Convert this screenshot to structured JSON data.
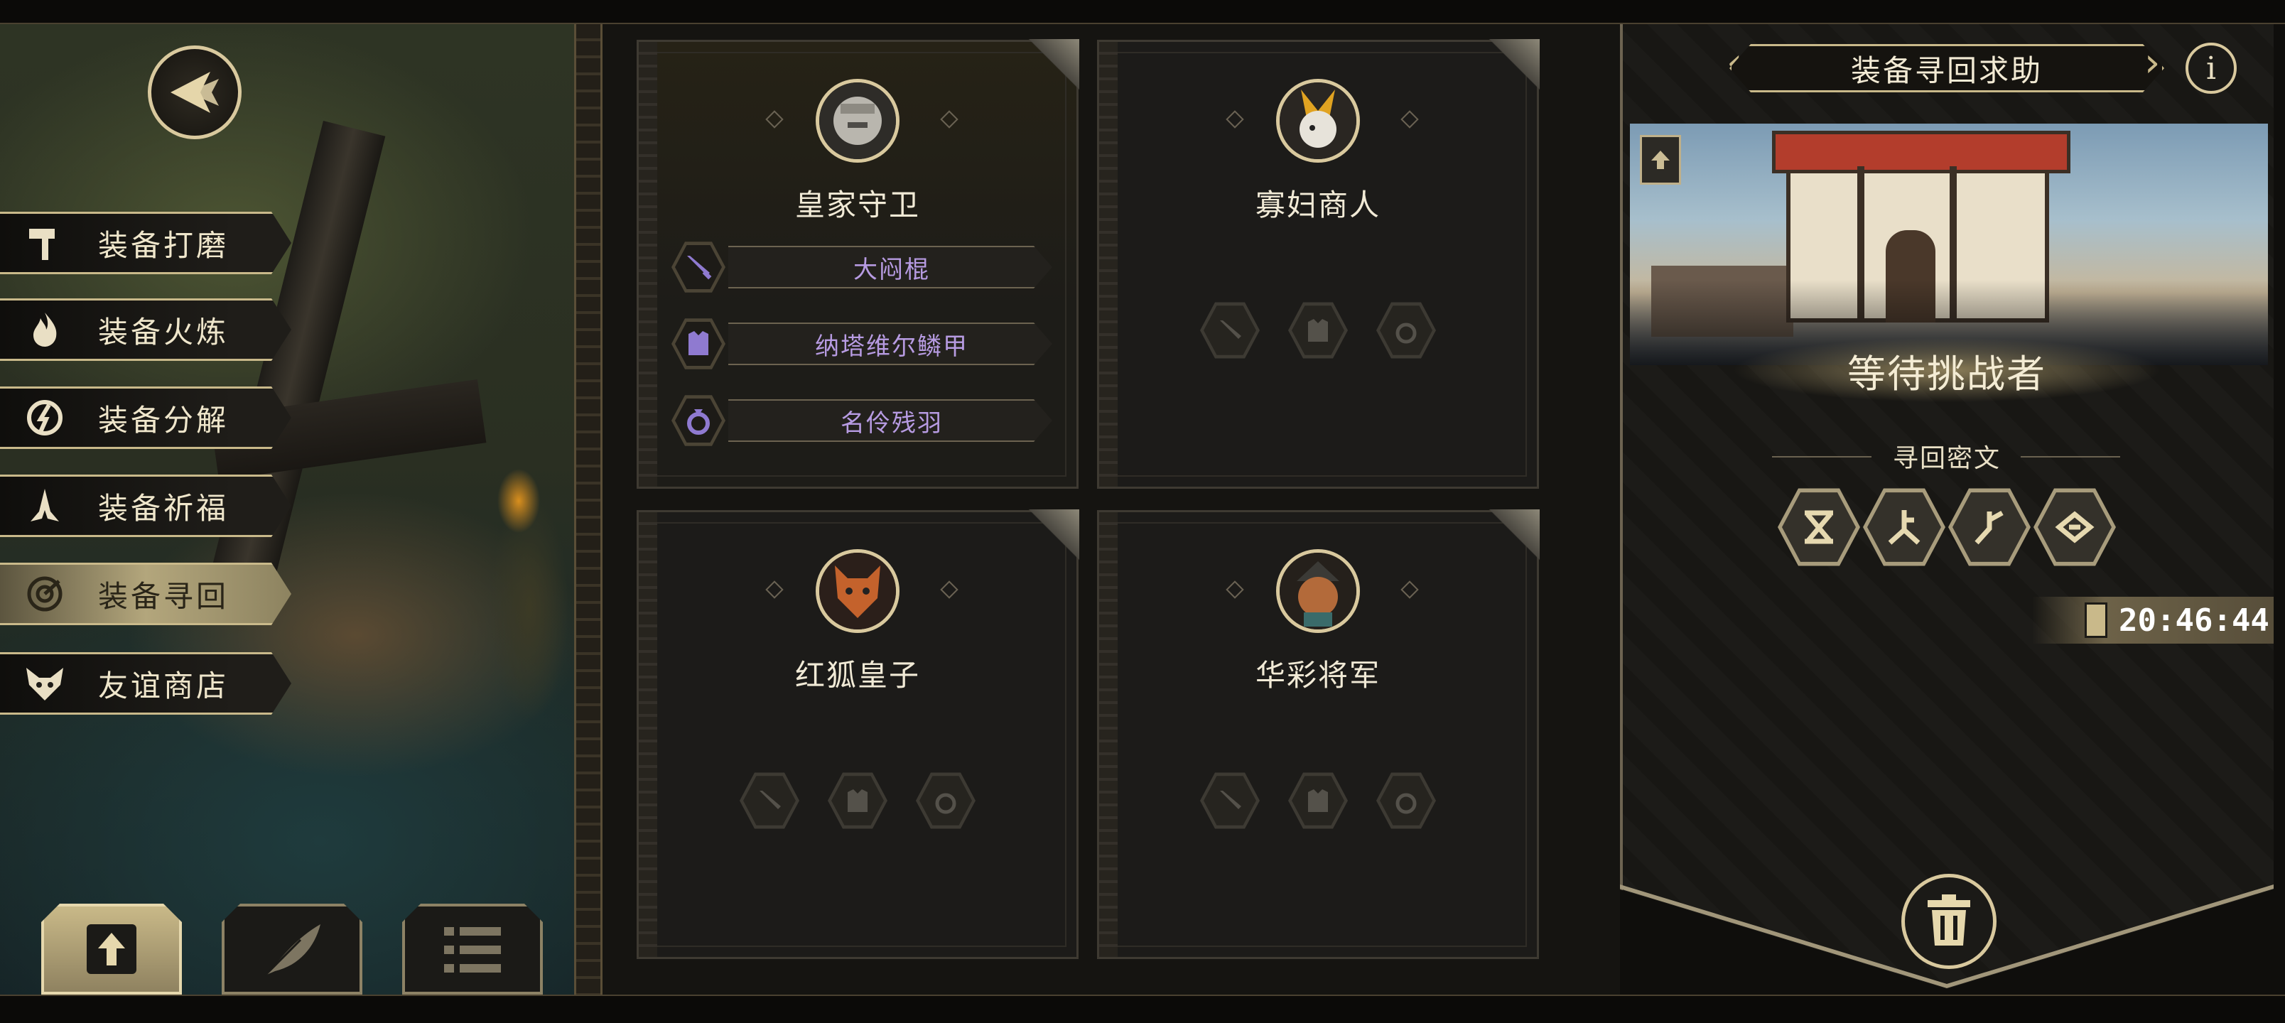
{
  "menu": {
    "items": [
      {
        "label": "装备打磨",
        "icon": "hammer-icon"
      },
      {
        "label": "装备火炼",
        "icon": "flame-icon"
      },
      {
        "label": "装备分解",
        "icon": "disassemble-icon"
      },
      {
        "label": "装备祈福",
        "icon": "pray-icon"
      },
      {
        "label": "装备寻回",
        "icon": "target-icon",
        "active": true
      },
      {
        "label": "友谊商店",
        "icon": "fox-icon"
      }
    ]
  },
  "cards": [
    {
      "name": "皇家守卫",
      "active": true,
      "equipment": [
        {
          "slot": "weapon",
          "item": "大闷棍"
        },
        {
          "slot": "armor",
          "item": "纳塔维尔鳞甲"
        },
        {
          "slot": "ring",
          "item": "名伶残羽"
        }
      ]
    },
    {
      "name": "寡妇商人",
      "active": false
    },
    {
      "name": "红狐皇子",
      "active": false
    },
    {
      "name": "华彩将军",
      "active": false
    }
  ],
  "panel": {
    "title": "装备寻回求助",
    "info_label": "i",
    "status": "等待挑战者",
    "runes_title": "寻回密文",
    "timer": "20:46:44"
  },
  "colors": {
    "gold": "#d9c99e",
    "equip_text": "#b79be2",
    "active_menu": "#b3a67c"
  }
}
